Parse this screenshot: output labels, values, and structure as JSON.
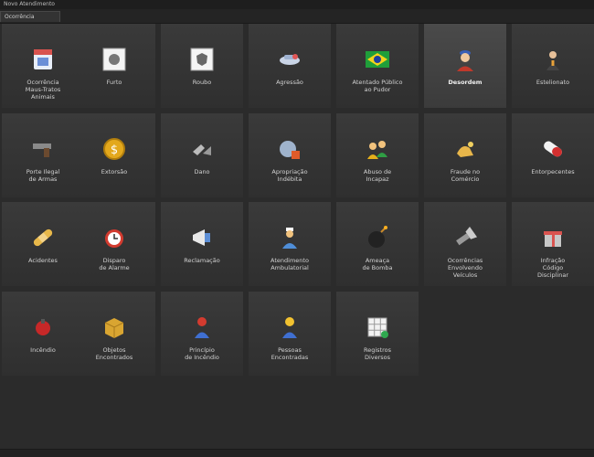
{
  "window": {
    "title": "Novo Atendimento"
  },
  "tabs": [
    {
      "label": "Ocorrência"
    }
  ],
  "tiles": [
    {
      "label": "Ocorrência\nMaus-Tratos\nAnimais"
    },
    {
      "label": "Furto"
    },
    {
      "label": "Roubo"
    },
    {
      "label": "Agressão"
    },
    {
      "label": "Atentado Público\nao Pudor"
    },
    {
      "label": "Desordem"
    },
    {
      "label": "Estelionato"
    },
    {
      "label": "Porte Ilegal\nde Armas"
    },
    {
      "label": "Extorsão"
    },
    {
      "label": "Dano"
    },
    {
      "label": "Apropriação\nIndébita"
    },
    {
      "label": "Abuso de\nIncapaz"
    },
    {
      "label": "Fraude no\nComércio"
    },
    {
      "label": "Entorpecentes"
    },
    {
      "label": "Acidentes"
    },
    {
      "label": "Disparo\nde Alarme"
    },
    {
      "label": "Reclamação"
    },
    {
      "label": "Atendimento\nAmbulatorial"
    },
    {
      "label": "Ameaça\nde Bomba"
    },
    {
      "label": "Ocorrências\nEnvolvendo\nVeículos"
    },
    {
      "label": "Infração\nCódigo\nDisciplinar"
    },
    {
      "label": "Incêndio"
    },
    {
      "label": "Objetos\nEncontrados"
    },
    {
      "label": "Princípio\nde Incêndio"
    },
    {
      "label": "Pessoas\nEncontradas"
    },
    {
      "label": "Registros\nDiversos"
    }
  ],
  "selected_tile": "Desordem",
  "colors": {
    "background": "#2b2b2b",
    "tile": "#353535",
    "tile_selected": "#444444"
  }
}
